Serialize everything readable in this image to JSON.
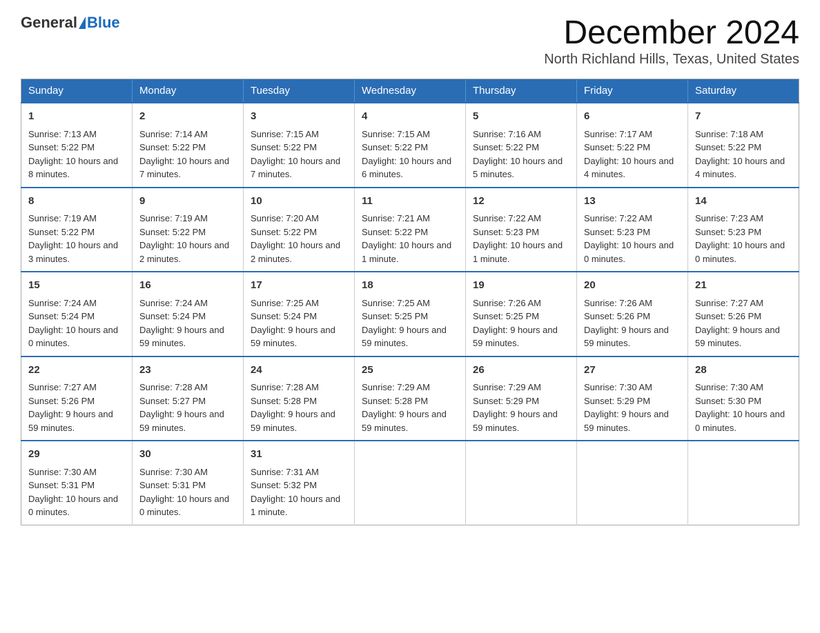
{
  "logo": {
    "general": "General",
    "blue": "Blue"
  },
  "title": {
    "month": "December 2024",
    "location": "North Richland Hills, Texas, United States"
  },
  "weekdays": [
    "Sunday",
    "Monday",
    "Tuesday",
    "Wednesday",
    "Thursday",
    "Friday",
    "Saturday"
  ],
  "weeks": [
    [
      {
        "day": "1",
        "sunrise": "7:13 AM",
        "sunset": "5:22 PM",
        "daylight": "10 hours and 8 minutes."
      },
      {
        "day": "2",
        "sunrise": "7:14 AM",
        "sunset": "5:22 PM",
        "daylight": "10 hours and 7 minutes."
      },
      {
        "day": "3",
        "sunrise": "7:15 AM",
        "sunset": "5:22 PM",
        "daylight": "10 hours and 7 minutes."
      },
      {
        "day": "4",
        "sunrise": "7:15 AM",
        "sunset": "5:22 PM",
        "daylight": "10 hours and 6 minutes."
      },
      {
        "day": "5",
        "sunrise": "7:16 AM",
        "sunset": "5:22 PM",
        "daylight": "10 hours and 5 minutes."
      },
      {
        "day": "6",
        "sunrise": "7:17 AM",
        "sunset": "5:22 PM",
        "daylight": "10 hours and 4 minutes."
      },
      {
        "day": "7",
        "sunrise": "7:18 AM",
        "sunset": "5:22 PM",
        "daylight": "10 hours and 4 minutes."
      }
    ],
    [
      {
        "day": "8",
        "sunrise": "7:19 AM",
        "sunset": "5:22 PM",
        "daylight": "10 hours and 3 minutes."
      },
      {
        "day": "9",
        "sunrise": "7:19 AM",
        "sunset": "5:22 PM",
        "daylight": "10 hours and 2 minutes."
      },
      {
        "day": "10",
        "sunrise": "7:20 AM",
        "sunset": "5:22 PM",
        "daylight": "10 hours and 2 minutes."
      },
      {
        "day": "11",
        "sunrise": "7:21 AM",
        "sunset": "5:22 PM",
        "daylight": "10 hours and 1 minute."
      },
      {
        "day": "12",
        "sunrise": "7:22 AM",
        "sunset": "5:23 PM",
        "daylight": "10 hours and 1 minute."
      },
      {
        "day": "13",
        "sunrise": "7:22 AM",
        "sunset": "5:23 PM",
        "daylight": "10 hours and 0 minutes."
      },
      {
        "day": "14",
        "sunrise": "7:23 AM",
        "sunset": "5:23 PM",
        "daylight": "10 hours and 0 minutes."
      }
    ],
    [
      {
        "day": "15",
        "sunrise": "7:24 AM",
        "sunset": "5:24 PM",
        "daylight": "10 hours and 0 minutes."
      },
      {
        "day": "16",
        "sunrise": "7:24 AM",
        "sunset": "5:24 PM",
        "daylight": "9 hours and 59 minutes."
      },
      {
        "day": "17",
        "sunrise": "7:25 AM",
        "sunset": "5:24 PM",
        "daylight": "9 hours and 59 minutes."
      },
      {
        "day": "18",
        "sunrise": "7:25 AM",
        "sunset": "5:25 PM",
        "daylight": "9 hours and 59 minutes."
      },
      {
        "day": "19",
        "sunrise": "7:26 AM",
        "sunset": "5:25 PM",
        "daylight": "9 hours and 59 minutes."
      },
      {
        "day": "20",
        "sunrise": "7:26 AM",
        "sunset": "5:26 PM",
        "daylight": "9 hours and 59 minutes."
      },
      {
        "day": "21",
        "sunrise": "7:27 AM",
        "sunset": "5:26 PM",
        "daylight": "9 hours and 59 minutes."
      }
    ],
    [
      {
        "day": "22",
        "sunrise": "7:27 AM",
        "sunset": "5:26 PM",
        "daylight": "9 hours and 59 minutes."
      },
      {
        "day": "23",
        "sunrise": "7:28 AM",
        "sunset": "5:27 PM",
        "daylight": "9 hours and 59 minutes."
      },
      {
        "day": "24",
        "sunrise": "7:28 AM",
        "sunset": "5:28 PM",
        "daylight": "9 hours and 59 minutes."
      },
      {
        "day": "25",
        "sunrise": "7:29 AM",
        "sunset": "5:28 PM",
        "daylight": "9 hours and 59 minutes."
      },
      {
        "day": "26",
        "sunrise": "7:29 AM",
        "sunset": "5:29 PM",
        "daylight": "9 hours and 59 minutes."
      },
      {
        "day": "27",
        "sunrise": "7:30 AM",
        "sunset": "5:29 PM",
        "daylight": "9 hours and 59 minutes."
      },
      {
        "day": "28",
        "sunrise": "7:30 AM",
        "sunset": "5:30 PM",
        "daylight": "10 hours and 0 minutes."
      }
    ],
    [
      {
        "day": "29",
        "sunrise": "7:30 AM",
        "sunset": "5:31 PM",
        "daylight": "10 hours and 0 minutes."
      },
      {
        "day": "30",
        "sunrise": "7:30 AM",
        "sunset": "5:31 PM",
        "daylight": "10 hours and 0 minutes."
      },
      {
        "day": "31",
        "sunrise": "7:31 AM",
        "sunset": "5:32 PM",
        "daylight": "10 hours and 1 minute."
      },
      null,
      null,
      null,
      null
    ]
  ],
  "labels": {
    "sunrise": "Sunrise:",
    "sunset": "Sunset:",
    "daylight": "Daylight:"
  }
}
